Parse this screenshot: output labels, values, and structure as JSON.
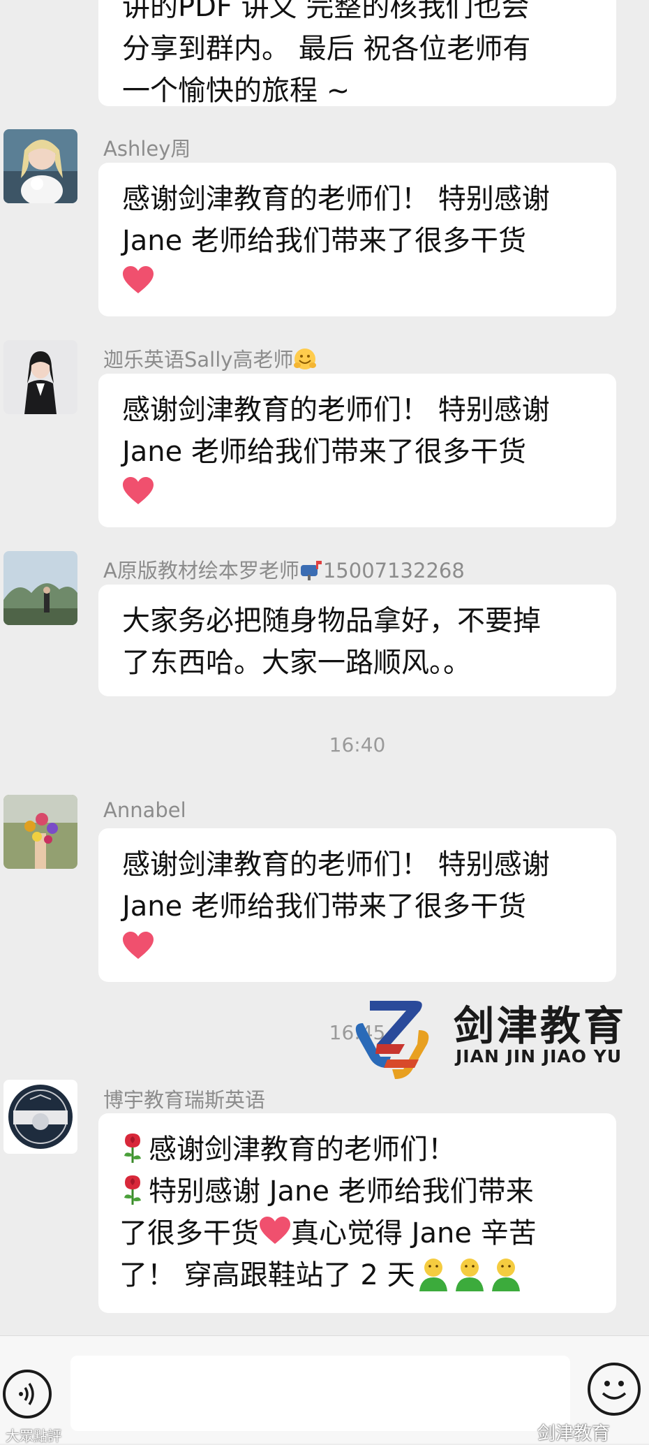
{
  "messages": [
    {
      "lines": [
        "讲的PDF 讲义 完整的核我们也会",
        "分享到群内。 最后 祝各位老师有",
        "一个愉快的旅程 ~"
      ]
    },
    {
      "sender": "Ashley周",
      "lines": [
        "感谢剑津教育的老师们！ 特别感谢",
        "Jane 老师给我们带来了很多干货"
      ],
      "emoji": "red-heart"
    },
    {
      "sender": "迦乐英语Sally高老师",
      "sender_emoji": "smiling-face-hands",
      "lines": [
        "感谢剑津教育的老师们！ 特别感谢",
        "Jane 老师给我们带来了很多干货"
      ],
      "emoji": "red-heart"
    },
    {
      "sender_name": "A原版教材绘本罗老师",
      "sender_icon": "mailbox",
      "sender_phone": "15007132268",
      "lines": [
        "大家务必把随身物品拿好，不要掉",
        "了东西哈。大家一路顺风。。"
      ]
    },
    {
      "sender": "Annabel",
      "lines": [
        "感谢剑津教育的老师们！ 特别感谢",
        "Jane 老师给我们带来了很多干货"
      ],
      "emoji": "red-heart"
    },
    {
      "sender": "博宇教育瑞斯英语",
      "line1": "感谢剑津教育的老师们！",
      "line2": "特别感谢 Jane 老师给我们带来",
      "line3a": "了很多干货",
      "line3b": "真心觉得 Jane 辛苦",
      "line4": "了！ 穿高跟鞋站了 2 天"
    }
  ],
  "timestamps": [
    "16:40",
    "16:45"
  ],
  "logo": {
    "cn": "剑津教育",
    "en": "JIAN JIN JIAO YU"
  },
  "input": {
    "placeholder": ""
  },
  "watermarks": {
    "left": "大眾點評",
    "right": "剑津教育"
  },
  "colors": {
    "background": "#ededed",
    "bubble": "#ffffff",
    "sender": "#8c8c8c",
    "heart": "#f0506e"
  }
}
